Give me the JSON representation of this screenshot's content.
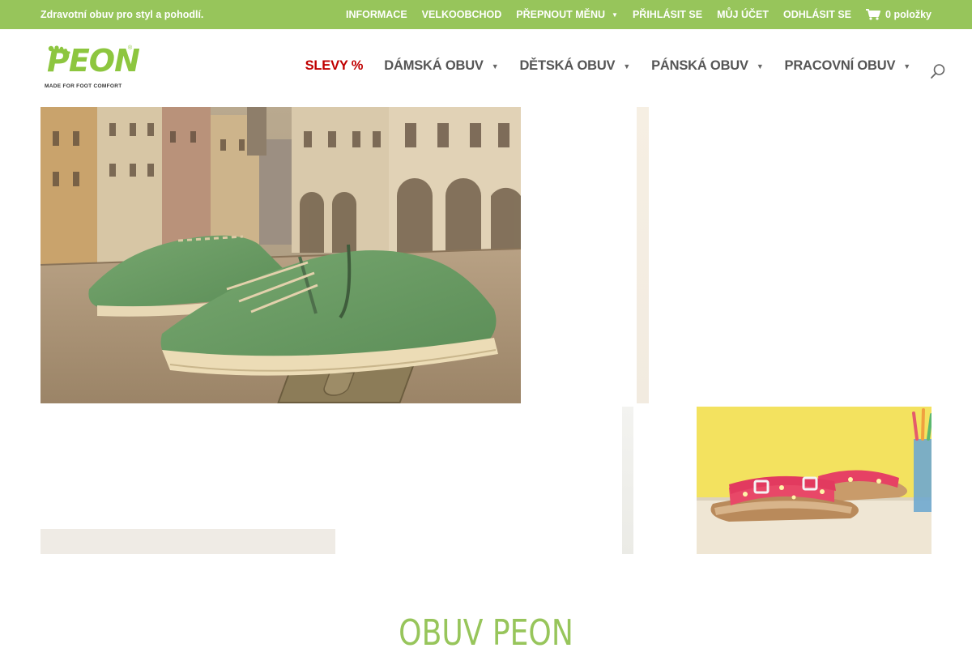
{
  "topbar": {
    "tagline": "Zdravotní obuv pro styl a pohodlí.",
    "links": [
      {
        "label": "INFORMACE",
        "dropdown": false
      },
      {
        "label": "VELKOOBCHOD",
        "dropdown": false
      },
      {
        "label": "PŘEPNOUT MĚNU",
        "dropdown": true
      },
      {
        "label": "PŘIHLÁSIT SE",
        "dropdown": false
      },
      {
        "label": "MŮJ ÚČET",
        "dropdown": false
      },
      {
        "label": "ODHLÁSIT SE",
        "dropdown": false
      }
    ],
    "cart_label": "0 položky",
    "background": "#97c55b"
  },
  "logo": {
    "brand": "PEON",
    "slogan": "MADE FOR FOOT COMFORT"
  },
  "nav": {
    "items": [
      {
        "label": "SLEVY %",
        "dropdown": false,
        "highlight": true
      },
      {
        "label": "DÁMSKÁ OBUV",
        "dropdown": true
      },
      {
        "label": "DĚTSKÁ OBUV",
        "dropdown": true
      },
      {
        "label": "PÁNSKÁ OBUV",
        "dropdown": true
      },
      {
        "label": "PRACOVNÍ OBUV",
        "dropdown": true
      }
    ],
    "sale_color": "#c00000"
  },
  "section": {
    "title": "OBUV PEON",
    "accent": "#97c55b"
  }
}
